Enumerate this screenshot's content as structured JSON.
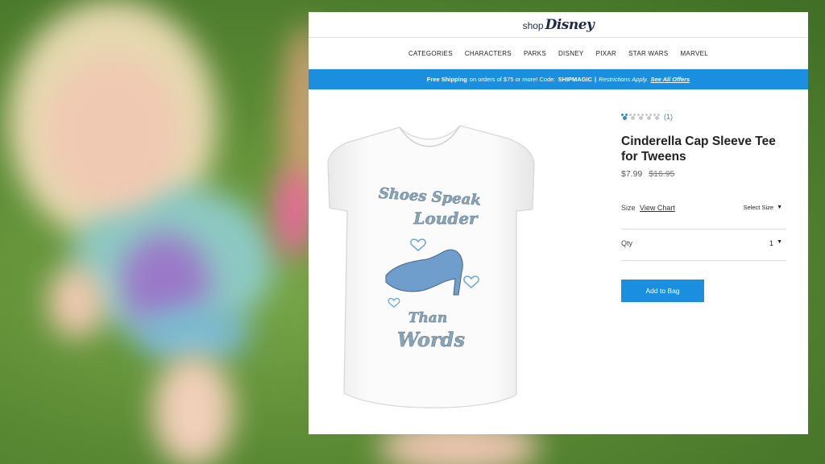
{
  "header": {
    "logo_shop": "shop",
    "logo_disney": "Disney"
  },
  "nav": {
    "items": [
      "CATEGORIES",
      "CHARACTERS",
      "PARKS",
      "DISNEY",
      "PIXAR",
      "STAR WARS",
      "MARVEL"
    ]
  },
  "promo": {
    "part1": "Free Shipping",
    "part2": "on orders of $75 or more! Code:",
    "code": "SHIPMAGIC",
    "separator": "|",
    "restrictions": "Restrictions Apply.",
    "link": "See All Offers"
  },
  "product": {
    "rating_count": "(1)",
    "rating_value": 1,
    "rating_max": 5,
    "title": "Cinderella Cap Sleeve Tee for Tweens",
    "price": "$7.99",
    "original_price": "$16.95",
    "size_label": "Size",
    "size_chart_link": "View Chart",
    "size_select": "Select Size",
    "qty_label": "Qty",
    "qty_value": "1",
    "add_button": "Add to Bag",
    "shirt_text": [
      "Shoes Speak",
      "Louder",
      "Than",
      "Words"
    ]
  },
  "colors": {
    "accent": "#1a8fe0",
    "mickey_filled": "#2a8ad8",
    "mickey_empty": "#c8c8c8"
  },
  "icons": {
    "rating": "mickey-head-icon",
    "caret": "caret-down-icon"
  }
}
